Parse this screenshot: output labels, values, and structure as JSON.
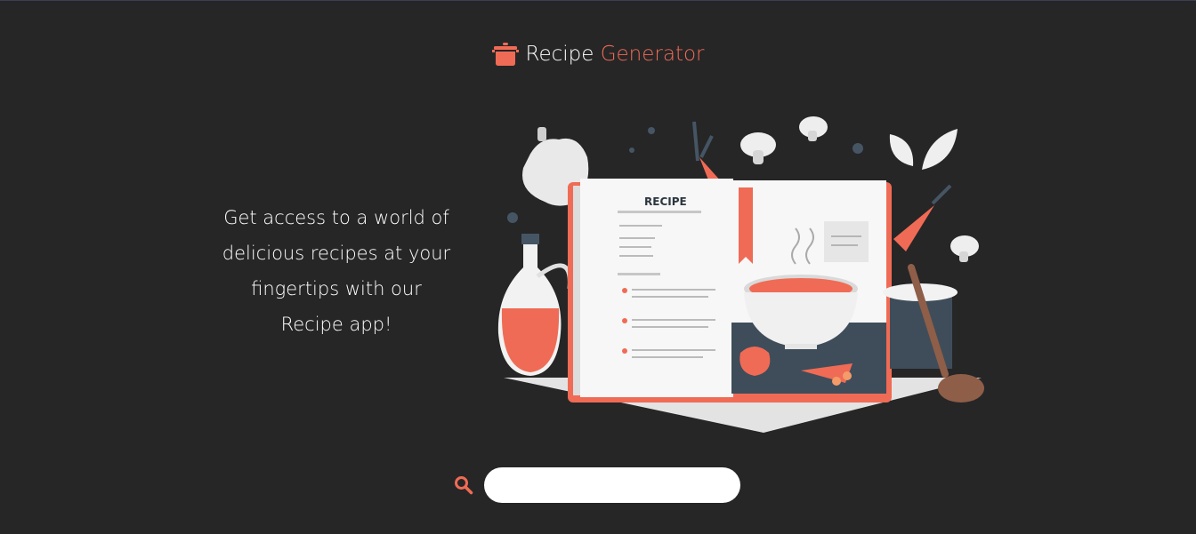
{
  "header": {
    "title_primary": "Recipe",
    "title_accent": "Generator",
    "logo_icon": "cooking-pot-icon"
  },
  "hero": {
    "tagline_lines": [
      "Get access to a world of",
      "delicious recipes at your",
      "fingertips with our",
      "Recipe app!"
    ],
    "illustration": {
      "name": "open-recipe-book-illustration",
      "book_label": "RECIPE"
    }
  },
  "search": {
    "icon": "search-icon",
    "placeholder": "",
    "value": ""
  },
  "colors": {
    "background": "#262627",
    "accent": "#f06b55",
    "text": "#ffffff",
    "slate": "#3f4d5a"
  }
}
